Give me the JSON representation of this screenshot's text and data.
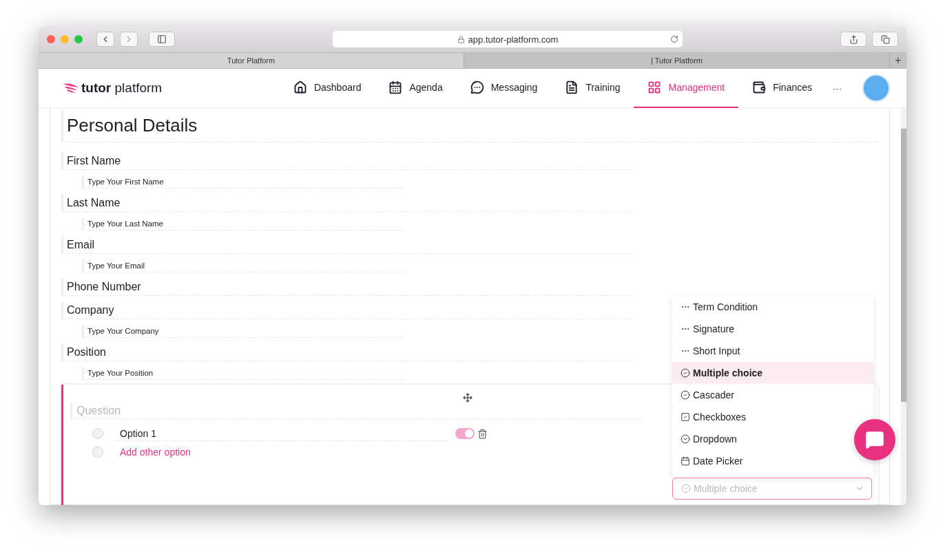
{
  "browser": {
    "url": "app.tutor-platform.com",
    "tabs": [
      {
        "title": "Tutor Platform",
        "selected": true
      },
      {
        "title": "| Tutor Platform",
        "selected": false
      }
    ],
    "new_tab": "+"
  },
  "nav": {
    "logo": "**tutor** platform",
    "items": [
      {
        "label": "Dashboard",
        "kind": "home",
        "selected": false
      },
      {
        "label": "Agenda",
        "kind": "calendar",
        "selected": false
      },
      {
        "label": "Messaging",
        "kind": "chat",
        "selected": false
      },
      {
        "label": "Training",
        "kind": "doc",
        "selected": false
      },
      {
        "label": "Management",
        "kind": "grid",
        "selected": true
      },
      {
        "label": "Finances",
        "kind": "wallet",
        "selected": false
      }
    ],
    "more": "···"
  },
  "form": {
    "title": "Personal Details",
    "fields": [
      {
        "label": "First Name",
        "placeholder": "Type Your First Name"
      },
      {
        "label": "Last Name",
        "placeholder": "Type Your Last Name"
      },
      {
        "label": "Email",
        "placeholder": "Type Your Email"
      },
      {
        "label": "Phone Number"
      },
      {
        "label": "Company",
        "placeholder": "Type Your Company"
      },
      {
        "label": "Position",
        "placeholder": "Type Your Position"
      }
    ]
  },
  "question": {
    "placeholder": "Question",
    "options": [
      {
        "label": "Option 1",
        "selected": false
      }
    ],
    "add_option": {
      "label": "Add other option",
      "selected": false
    },
    "required_toggle": {
      "on": true
    }
  },
  "type_menu": {
    "items": [
      {
        "label": "Term Condition",
        "kind": "dots",
        "selected": false
      },
      {
        "label": "Signature",
        "kind": "dots",
        "selected": false
      },
      {
        "label": "Short Input",
        "kind": "dots",
        "selected": false
      },
      {
        "label": "Multiple choice",
        "kind": "circle-check",
        "selected": true
      },
      {
        "label": "Cascader",
        "kind": "circle-check",
        "selected": false
      },
      {
        "label": "Checkboxes",
        "kind": "square-check",
        "selected": false
      },
      {
        "label": "Dropdown",
        "kind": "circle-chevron",
        "selected": false
      },
      {
        "label": "Date Picker",
        "kind": "calendar",
        "selected": false
      }
    ]
  },
  "type_select": {
    "value": "Multiple choice",
    "kind": "circle-check"
  }
}
